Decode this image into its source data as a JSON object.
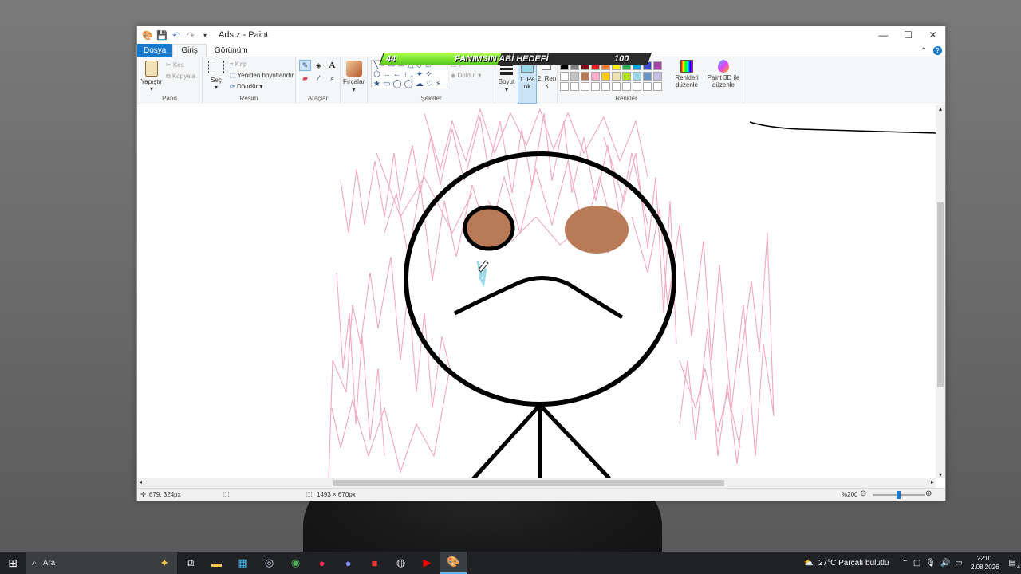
{
  "window": {
    "title": "Adsız - Paint"
  },
  "menu": {
    "file": "Dosya",
    "tabs": [
      "Giriş",
      "Görünüm"
    ]
  },
  "ribbon": {
    "pano": {
      "paste": "Yapıştır",
      "cut": "Kes",
      "copy": "Kopyala",
      "label": "Pano"
    },
    "resim": {
      "select": "Seç",
      "crop": "Kırp",
      "resize": "Yeniden boyutlandır",
      "rotate": "Döndür",
      "label": "Resim"
    },
    "araclar": {
      "label": "Araçlar"
    },
    "brushes": {
      "label": "Fırçalar"
    },
    "shapes": {
      "fill": "Doldur",
      "label": "Şekiller"
    },
    "size": {
      "label": "Boyut"
    },
    "color1": {
      "label": "1. Renk"
    },
    "color2": {
      "label": "2. Renk"
    },
    "colors": {
      "label": "Renkler",
      "edit": "Renkleri düzenle",
      "paint3d": "Paint 3D ile düzenle",
      "palette": [
        "#000000",
        "#7f7f7f",
        "#880015",
        "#ed1c24",
        "#ff7f27",
        "#fff200",
        "#22b14c",
        "#00a2e8",
        "#3f48cc",
        "#a349a4",
        "#ffffff",
        "#c3c3c3",
        "#b97a57",
        "#ffaec9",
        "#ffc90e",
        "#efe4b0",
        "#b5e61d",
        "#99d9ea",
        "#7092be",
        "#c8bfe7"
      ]
    },
    "color1_value": "#99d9ea",
    "color2_value": "#ffffff"
  },
  "overlay": {
    "current": "44",
    "label": "FANIMSIN ABİ HEDEFİ",
    "target": "100",
    "progress": 0.44
  },
  "status": {
    "cursor": "679, 324px",
    "size": "1493 × 670px",
    "zoom": "%200"
  },
  "taskbar": {
    "search_placeholder": "Ara",
    "weather": "27°C  Parçalı bulutlu",
    "time": "22:01",
    "date": "2.08.2026",
    "notification_count": "4"
  }
}
